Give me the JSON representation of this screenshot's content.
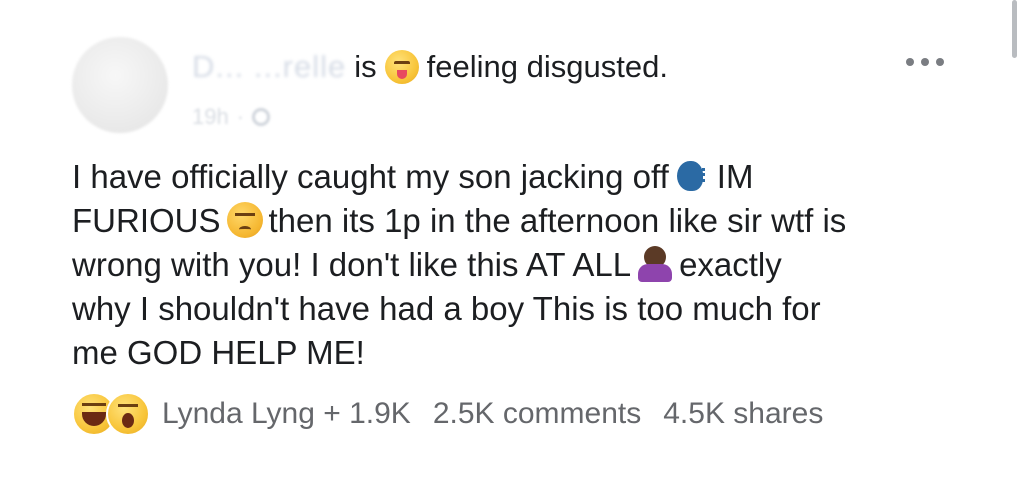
{
  "post": {
    "author_name": "D... ...relle",
    "author_visible_fragment": "elle",
    "activity_verb": "is",
    "feeling_icon": "disgusted-emoji-icon",
    "feeling_text": "feeling disgusted.",
    "timestamp": "19h",
    "meta_separator": "·",
    "privacy_icon": "globe-icon",
    "more_icon": "more-options-icon",
    "body_lines": [
      {
        "pre": "I have officially caught my son jacking off",
        "emoji": "speaking-head-icon",
        "post": "IM"
      },
      {
        "pre": "FURIOUS",
        "emoji": "angry-face-icon",
        "post": "then its 1p in the afternoon like sir wtf is"
      },
      {
        "pre": "wrong with you! I don't like this AT ALL",
        "emoji": "no-gesture-icon",
        "post": "exactly"
      },
      {
        "pre": "why I shouldn't have had a boy This is too much for",
        "emoji": "",
        "post": ""
      },
      {
        "pre": "me GOD HELP ME!",
        "emoji": "",
        "post": ""
      }
    ]
  },
  "footer": {
    "reaction_icons": [
      "haha-reaction-icon",
      "wow-reaction-icon"
    ],
    "reactors_text": "Lynda Lyng + 1.9K",
    "comments_text": "2.5K comments",
    "shares_text": "4.5K shares"
  },
  "colors": {
    "text": "#1c1e21",
    "secondary_text": "#65676b",
    "reaction_yellow": "#f8c53a"
  }
}
